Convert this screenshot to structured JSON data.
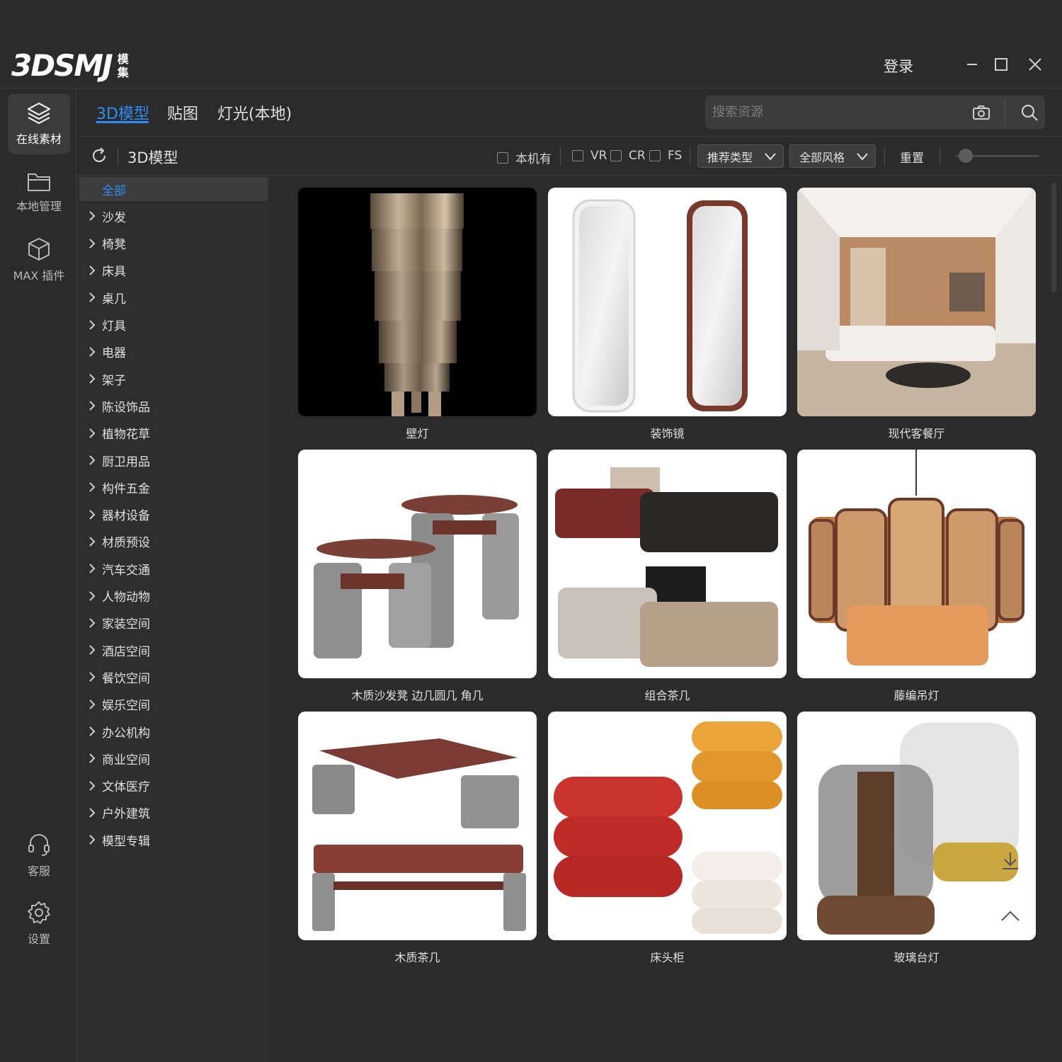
{
  "app": {
    "logo_text": "3DSMJ",
    "logo_sub_1": "模",
    "logo_sub_2": "集",
    "login_label": "登录"
  },
  "rail": {
    "items": [
      {
        "label": "在线素材",
        "icon": "layers-icon"
      },
      {
        "label": "本地管理",
        "icon": "folder-icon"
      },
      {
        "label": "MAX 插件",
        "icon": "cube-icon"
      },
      {
        "label": "客服",
        "icon": "headset-icon"
      },
      {
        "label": "设置",
        "icon": "gear-icon"
      }
    ]
  },
  "tabs": [
    {
      "label": "3D模型"
    },
    {
      "label": "贴图"
    },
    {
      "label": "灯光(本地)"
    }
  ],
  "search": {
    "placeholder": "搜索资源"
  },
  "filters": {
    "breadcrumb": "3D模型",
    "local_only": "本机有",
    "vr": "VR",
    "cr": "CR",
    "fs": "FS",
    "type_dropdown": "推荐类型",
    "style_dropdown": "全部风格",
    "reset": "重置",
    "size_slider_value": 0.05
  },
  "categories": [
    "全部",
    "沙发",
    "椅凳",
    "床具",
    "桌几",
    "灯具",
    "电器",
    "架子",
    "陈设饰品",
    "植物花草",
    "厨卫用品",
    "构件五金",
    "器材设备",
    "材质预设",
    "汽车交通",
    "人物动物",
    "家装空间",
    "酒店空间",
    "餐饮空间",
    "娱乐空间",
    "办公机构",
    "商业空间",
    "文体医疗",
    "户外建筑",
    "模型专辑"
  ],
  "models": [
    {
      "title": "壁灯"
    },
    {
      "title": "装饰镜"
    },
    {
      "title": "现代客餐厅"
    },
    {
      "title": "木质沙发凳 边几圆几 角几"
    },
    {
      "title": "组合茶几"
    },
    {
      "title": "藤编吊灯"
    },
    {
      "title": "木质茶几"
    },
    {
      "title": "床头柜"
    },
    {
      "title": "玻璃台灯"
    }
  ],
  "colors": {
    "accent": "#2f8cf3",
    "background": "#2b2b2c"
  }
}
